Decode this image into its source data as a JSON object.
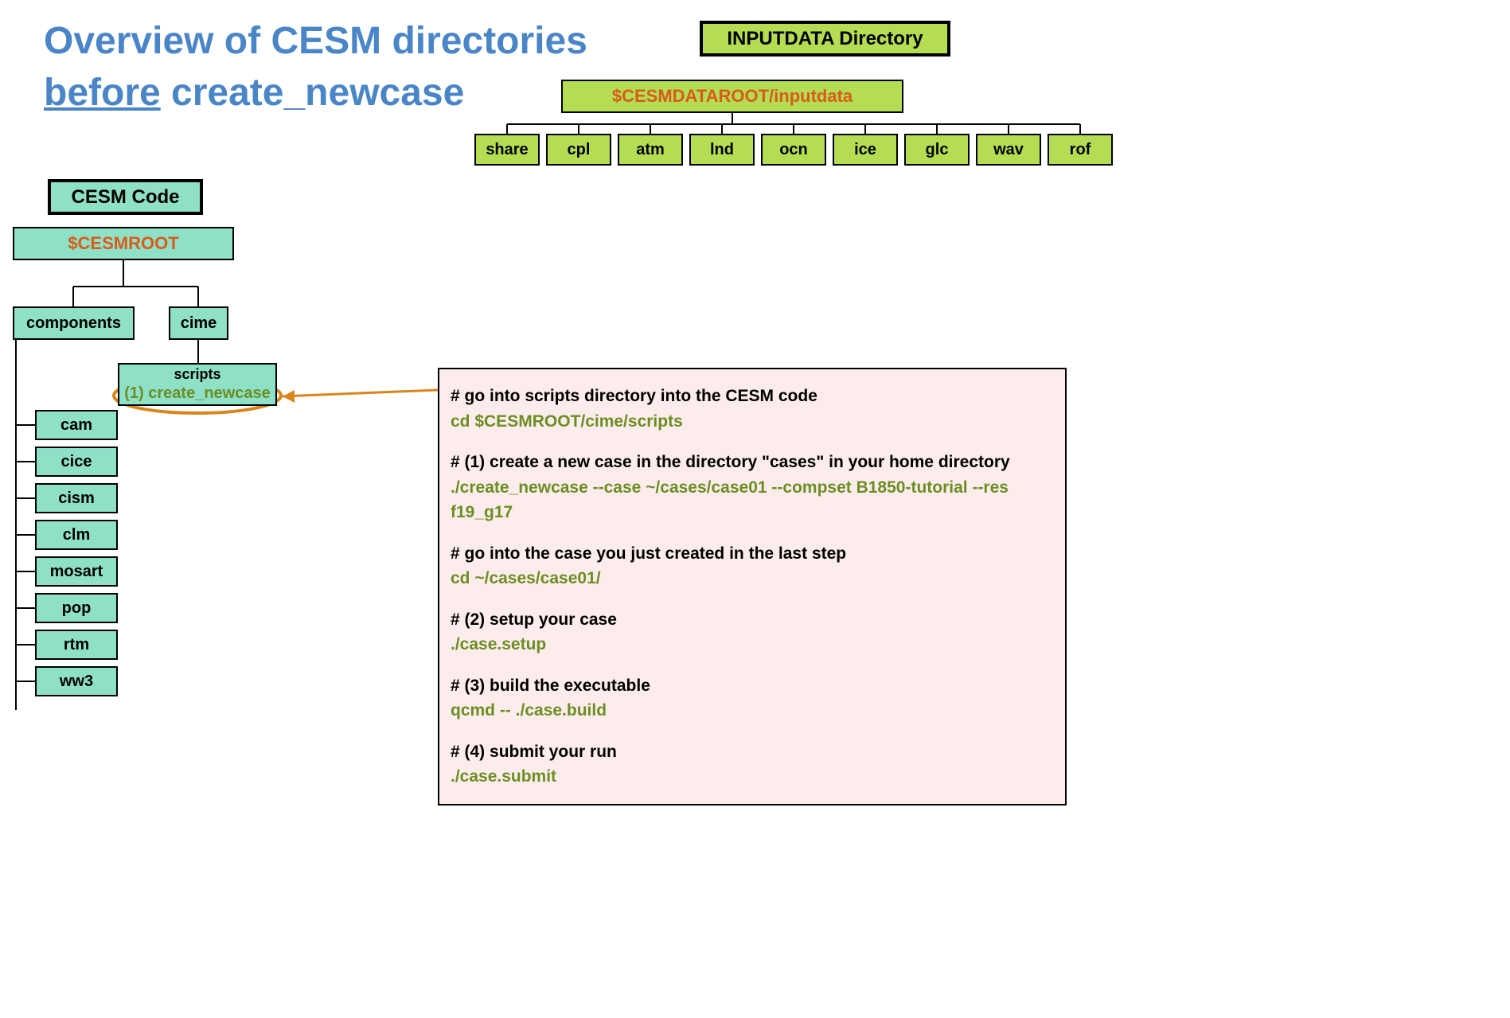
{
  "title_pre": "Overview of CESM directories",
  "title_underline": "before",
  "title_post": " create_newcase",
  "inputdata": {
    "label": "INPUTDATA Directory",
    "root": "$CESMDATAROOT/inputdata",
    "children": [
      "share",
      "cpl",
      "atm",
      "lnd",
      "ocn",
      "ice",
      "glc",
      "wav",
      "rof"
    ]
  },
  "cesm": {
    "label": "CESM Code",
    "root": "$CESMROOT",
    "components_label": "components",
    "cime_label": "cime",
    "scripts_label": "scripts",
    "scripts_sub": "(1) create_newcase",
    "component_list": [
      "cam",
      "cice",
      "cism",
      "clm",
      "mosart",
      "pop",
      "rtm",
      "ww3"
    ]
  },
  "code": {
    "lines": [
      {
        "comment": "# go into scripts directory into the CESM code",
        "cmd": "cd $CESMROOT/cime/scripts"
      },
      {
        "comment": "# (1) create a new case in the directory \"cases\" in your home directory",
        "cmd": "./create_newcase --case ~/cases/case01 --compset B1850-tutorial --res f19_g17"
      },
      {
        "comment": "# go into the case you just created in the last step",
        "cmd": "cd ~/cases/case01/"
      },
      {
        "comment": "# (2) setup your case",
        "cmd": "./case.setup"
      },
      {
        "comment": "# (3) build the executable",
        "cmd": "qcmd -- ./case.build"
      },
      {
        "comment": "# (4) submit your run",
        "cmd": "./case.submit"
      }
    ]
  }
}
